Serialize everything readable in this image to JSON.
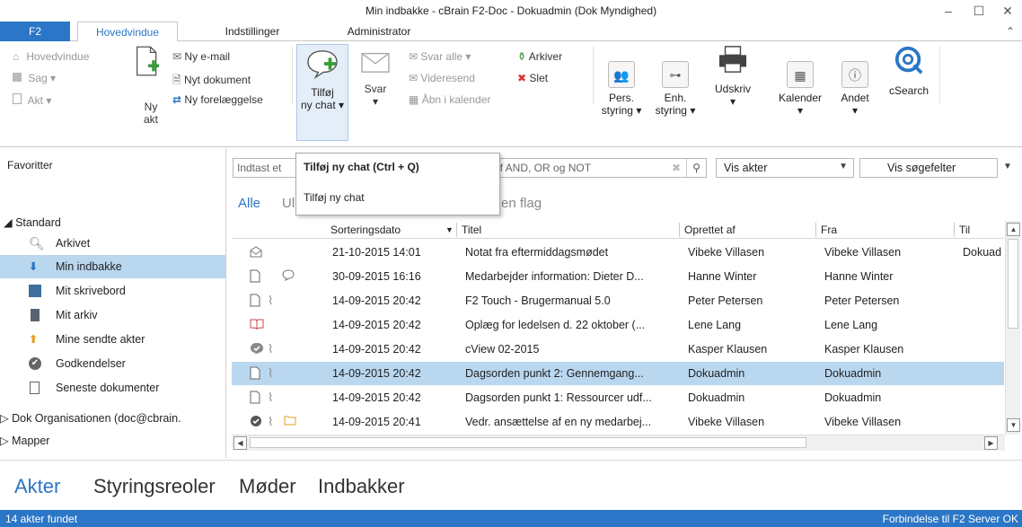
{
  "window": {
    "title": "Min indbakke - cBrain F2-Doc - Dokuadmin (Dok Myndighed)",
    "minimize": "–",
    "maximize": "☐",
    "close": "✕"
  },
  "ribbon_tabs": {
    "f2": "F2",
    "main": "Hovedvindue",
    "settings": "Indstillinger",
    "admin": "Administrator",
    "collapse": "⌃"
  },
  "ribbon": {
    "hovedvindue": "Hovedvindue",
    "sag": "Sag ▾",
    "akt": "Akt ▾",
    "ny_akt_1": "Ny",
    "ny_akt_2": "akt",
    "ny_email": "Ny e-mail",
    "nyt_dokument": "Nyt dokument",
    "ny_forelaeggelse": "Ny forelæggelse",
    "tilfoej_1": "Tilføj",
    "tilfoej_2": "ny chat ▾",
    "svar_1": "Svar",
    "svar_2": "▾",
    "svar_alle": "Svar alle ▾",
    "videresend": "Videresend",
    "aabn_kalender": "Åbn i kalender",
    "arkiver": "Arkiver",
    "slet": "Slet",
    "pers_1": "Pers.",
    "pers_2": "styring ▾",
    "enh_1": "Enh.",
    "enh_2": "styring ▾",
    "udskriv_1": "Udskriv",
    "udskriv_2": "▾",
    "kalender_1": "Kalender",
    "kalender_2": "▾",
    "andet_1": "Andet",
    "andet_2": "▾",
    "csearch": "cSearch"
  },
  "popup": {
    "title": "Tilføj ny chat (Ctrl + Q)",
    "desc": "Tilføj ny chat"
  },
  "search": {
    "placeholder_left": "Indtast et",
    "placeholder_right": "af AND, OR og NOT",
    "view": "Vis akter",
    "fields": "Vis søgefelter"
  },
  "filters": {
    "all": "Alle",
    "unread_partial": "Ul",
    "flag_partial": "en flag"
  },
  "sidebar": {
    "favorites": "Favoritter",
    "standard": "◢ Standard",
    "items": [
      {
        "label": "Arkivet"
      },
      {
        "label": "Min indbakke"
      },
      {
        "label": "Mit skrivebord"
      },
      {
        "label": "Mit arkiv"
      },
      {
        "label": "Mine sendte akter"
      },
      {
        "label": "Godkendelser"
      },
      {
        "label": "Seneste dokumenter"
      }
    ],
    "org": "▷ Dok Organisationen (doc@cbrain.",
    "folders": "▷ Mapper"
  },
  "grid": {
    "columns": {
      "date": "Sorteringsdato",
      "sort_arrow": "▼",
      "title": "Titel",
      "created_by": "Oprettet af",
      "from": "Fra",
      "to": "Til"
    },
    "rows": [
      {
        "date": "21-10-2015 14:01",
        "title": "Notat fra eftermiddagsmødet",
        "created": "Vibeke Villasen",
        "from": "Vibeke Villasen",
        "to": "Dokuad",
        "icon": "envelope-open",
        "clip": false,
        "chat": false,
        "folder": false
      },
      {
        "date": "30-09-2015 16:16",
        "title": "Medarbejder information: Dieter D...",
        "created": "Hanne Winter",
        "from": "Hanne Winter",
        "to": "",
        "icon": "document",
        "clip": false,
        "chat": true,
        "folder": false
      },
      {
        "date": "14-09-2015 20:42",
        "title": "F2 Touch - Brugermanual 5.0",
        "created": "Peter Petersen",
        "from": "Peter Petersen",
        "to": "",
        "icon": "document",
        "clip": true,
        "chat": false,
        "folder": false
      },
      {
        "date": "14-09-2015 20:42",
        "title": "Oplæg for ledelsen d. 22 oktober (...",
        "created": "Lene Lang",
        "from": "Lene Lang",
        "to": "",
        "icon": "book",
        "clip": false,
        "chat": false,
        "folder": false
      },
      {
        "date": "14-09-2015 20:42",
        "title": "cView 02-2015",
        "created": "Kasper Klausen",
        "from": "Kasper Klausen",
        "to": "",
        "icon": "approval-chat",
        "clip": true,
        "chat": false,
        "folder": false
      },
      {
        "date": "14-09-2015 20:42",
        "title": "Dagsorden punkt 2: Gennemgang...",
        "created": "Dokuadmin",
        "from": "Dokuadmin",
        "to": "",
        "icon": "document",
        "clip": true,
        "chat": false,
        "folder": false
      },
      {
        "date": "14-09-2015 20:42",
        "title": "Dagsorden punkt 1: Ressourcer udf...",
        "created": "Dokuadmin",
        "from": "Dokuadmin",
        "to": "",
        "icon": "document",
        "clip": true,
        "chat": false,
        "folder": false
      },
      {
        "date": "14-09-2015 20:41",
        "title": "Vedr. ansættelse af en ny medarbej...",
        "created": "Vibeke Villasen",
        "from": "Vibeke Villasen",
        "to": "",
        "icon": "check",
        "clip": true,
        "chat": false,
        "folder": true
      }
    ]
  },
  "bottom_nav": {
    "akter": "Akter",
    "styringsreoler": "Styringsreoler",
    "moeder": "Møder",
    "indbakker": "Indbakker"
  },
  "status": {
    "count": "14 akter fundet",
    "connection": "Forbindelse til F2 Server OK"
  },
  "colors": {
    "accent": "#2b76c6",
    "selection": "#bad7f0"
  }
}
